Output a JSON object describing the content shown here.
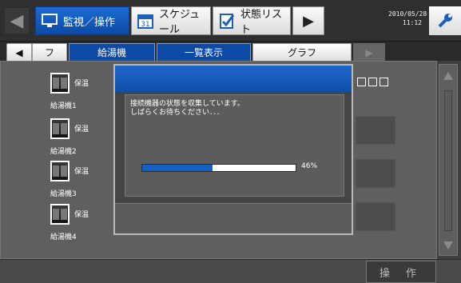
{
  "header": {
    "tabs": [
      {
        "label": "監視／操作",
        "icon": "monitor-icon",
        "active": true
      },
      {
        "label": "スケジュール",
        "icon": "calendar-icon",
        "active": false
      },
      {
        "label": "状態リスト",
        "icon": "checklist-icon",
        "active": false
      }
    ],
    "date": "2010/05/28",
    "time": "11:12"
  },
  "subnav": {
    "partial_tab_label": "フ",
    "group_label": "給湯機",
    "view_list_label": "一覧表示",
    "view_graph_label": "グラフ"
  },
  "devices": [
    {
      "name": "給湯機1",
      "status": "保温"
    },
    {
      "name": "給湯機2",
      "status": "保温"
    },
    {
      "name": "給湯機3",
      "status": "保温"
    },
    {
      "name": "給湯機4",
      "status": "保温"
    }
  ],
  "dialog": {
    "message": "接続機器の状態を収集しています。\nしばらくお待ちください．．．",
    "progress_fraction": 0.46,
    "progress_label": "46%"
  },
  "footer": {
    "operate_label": "操 作"
  },
  "colors": {
    "accent": "#0d4ea9",
    "progress": "#1560c4",
    "background": "#3f3f3f"
  }
}
